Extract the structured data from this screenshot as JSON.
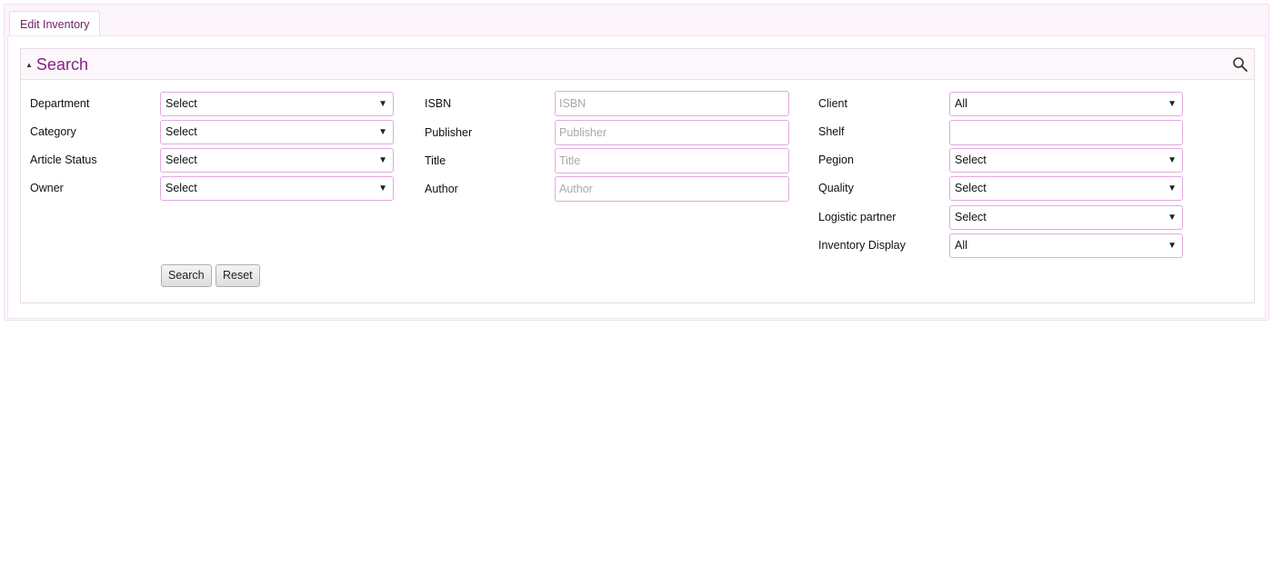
{
  "tab": {
    "label": "Edit Inventory"
  },
  "search": {
    "title": "Search"
  },
  "left_fields": [
    {
      "label": "Department",
      "value": "Select"
    },
    {
      "label": "Category",
      "value": "Select"
    },
    {
      "label": "Article Status",
      "value": "Select"
    },
    {
      "label": "Owner",
      "value": "Select"
    }
  ],
  "middle_fields": [
    {
      "label": "ISBN",
      "placeholder": "ISBN",
      "value": ""
    },
    {
      "label": "Publisher",
      "placeholder": "Publisher",
      "value": ""
    },
    {
      "label": "Title",
      "placeholder": "Title",
      "value": ""
    },
    {
      "label": "Author",
      "placeholder": "Author",
      "value": ""
    }
  ],
  "right_fields": {
    "client": {
      "label": "Client",
      "value": "All"
    },
    "shelf": {
      "label": "Shelf",
      "value": ""
    },
    "pegion": {
      "label": "Pegion",
      "value": "Select"
    },
    "quality": {
      "label": "Quality",
      "value": "Select"
    },
    "logistic_partner": {
      "label": "Logistic partner",
      "value": "Select"
    },
    "inventory_display": {
      "label": "Inventory Display",
      "value": "All"
    }
  },
  "buttons": {
    "search": "Search",
    "reset": "Reset"
  },
  "colors": {
    "accent": "#8a1f86",
    "field_border": "#e4a9df"
  }
}
